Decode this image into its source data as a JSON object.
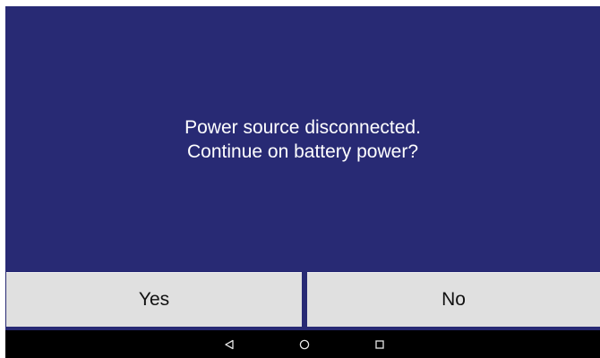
{
  "dialog": {
    "message_line1": "Power source disconnected.",
    "message_line2": "Continue on battery power?",
    "yes_label": "Yes",
    "no_label": "No"
  },
  "navigation_bar": {
    "icons": [
      "back-icon",
      "home-icon",
      "recents-icon"
    ]
  },
  "colors": {
    "background": "#282a74",
    "button": "#e0e0e0",
    "text_on_background": "#ffffff",
    "button_text": "#111111",
    "nav_bar": "#000000"
  }
}
